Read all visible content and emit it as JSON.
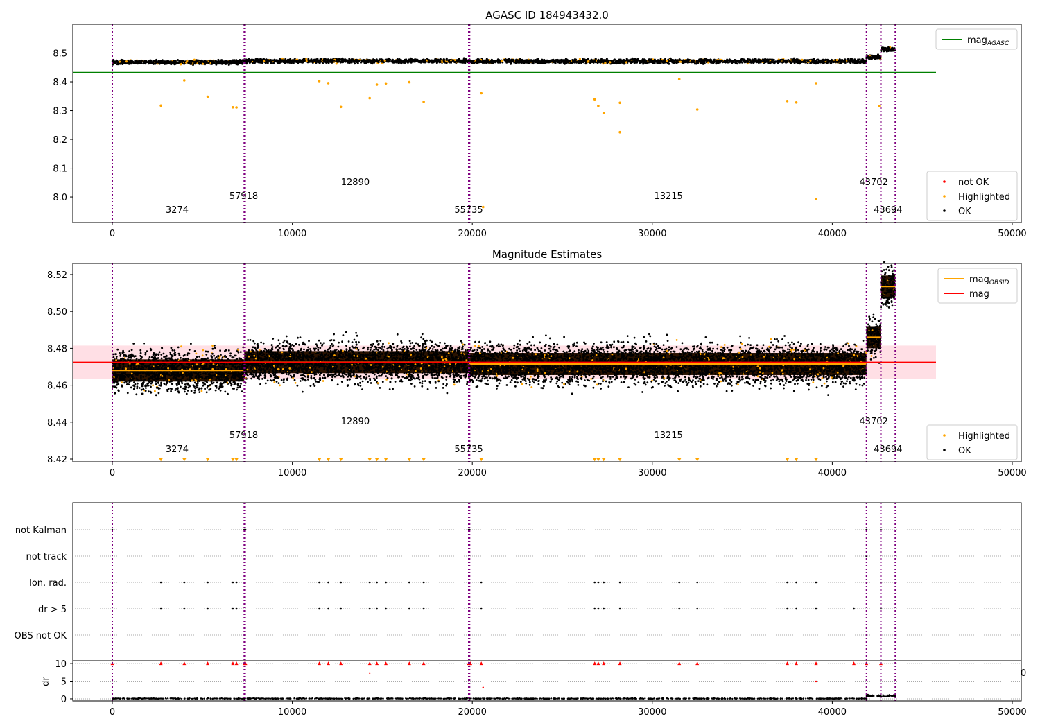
{
  "chart_data": [
    {
      "type": "scatter",
      "title": "AGASC ID 184943432.0",
      "xlim": [
        -2196,
        50500
      ],
      "ylim": [
        7.911,
        8.599
      ],
      "xticks": [
        "0",
        "10000",
        "20000",
        "30000",
        "40000",
        "50000"
      ],
      "yticks": [
        "8.0",
        "8.1",
        "8.2",
        "8.3",
        "8.4",
        "8.5"
      ],
      "mag_agasc": 8.432,
      "legend_top": {
        "position": "upper right",
        "entries": [
          {
            "label": "mag",
            "sub": "AGASC",
            "color": "#008000"
          }
        ]
      },
      "legend_bottom": {
        "position": "lower right",
        "entries": [
          {
            "label": "not OK",
            "color": "#ff0000"
          },
          {
            "label": "Highlighted",
            "color": "#ffa500"
          },
          {
            "label": "OK",
            "color": "#000000"
          }
        ]
      },
      "annotations_y": [
        7.94,
        7.99,
        8.04
      ]
    },
    {
      "type": "scatter",
      "title": "Magnitude Estimates",
      "xlim": [
        -2196,
        50500
      ],
      "ylim": [
        8.4185,
        8.526
      ],
      "xticks": [
        "0",
        "10000",
        "20000",
        "30000",
        "40000",
        "50000"
      ],
      "yticks": [
        "8.42",
        "8.44",
        "8.46",
        "8.48",
        "8.50",
        "8.52"
      ],
      "mag": 8.4724,
      "mag_band": [
        8.4635,
        8.4815
      ],
      "legend_top": {
        "position": "upper right",
        "entries": [
          {
            "label": "mag",
            "sub": "OBSID",
            "color": "#ffa500"
          },
          {
            "label": "mag",
            "sub": "",
            "color": "#ff0000"
          }
        ]
      },
      "legend_bottom": {
        "position": "lower right",
        "entries": [
          {
            "label": "Highlighted",
            "color": "#ffa500"
          },
          {
            "label": "OK",
            "color": "#000000"
          }
        ]
      }
    },
    {
      "type": "scatter",
      "title": "",
      "categories": [
        "not Kalman",
        "not track",
        "Ion. rad.",
        "dr > 5",
        "OBS not OK"
      ],
      "flags": {
        "not Kalman": [
          0,
          7330,
          7400,
          19800,
          19850,
          41900,
          42700
        ],
        "not track": [
          41900
        ],
        "Ion. rad.": [
          2700,
          4000,
          5300,
          6700,
          6900,
          11500,
          12000,
          12700,
          14300,
          14700,
          15200,
          16500,
          17300,
          20500,
          26800,
          27000,
          27300,
          28200,
          31500,
          32500,
          37500,
          38000,
          39100,
          42700
        ],
        "dr > 5": [
          2700,
          4000,
          5300,
          6700,
          6900,
          11500,
          12000,
          12700,
          14300,
          14700,
          15200,
          16500,
          17300,
          20500,
          26800,
          27000,
          27300,
          28200,
          31500,
          32500,
          37500,
          38000,
          39100,
          41200,
          42700
        ],
        "OBS not OK": []
      },
      "dr_panel": {
        "ylabel": "dr",
        "ylim": [
          -0.6,
          10.8
        ],
        "yticks": [
          "0",
          "5",
          "10"
        ],
        "clip_value": 10,
        "clipped_x": [
          0,
          2700,
          4000,
          5300,
          6700,
          6900,
          7330,
          7400,
          11500,
          12000,
          12700,
          14300,
          14700,
          15200,
          16500,
          17300,
          19800,
          19900,
          20500,
          26800,
          27000,
          27300,
          28200,
          31500,
          32500,
          37500,
          38000,
          39100,
          41200,
          41900,
          42700
        ],
        "extra_red": [
          [
            14300,
            7.3
          ],
          [
            20600,
            3.2
          ],
          [
            39100,
            4.9
          ]
        ]
      },
      "xticks": [
        "0",
        "10000",
        "20000",
        "30000",
        "40000",
        "50000"
      ],
      "stray_tick_label": "0"
    }
  ],
  "observations": [
    {
      "obsid": "3274",
      "start": 0,
      "end": 7330,
      "mag": 8.468,
      "label_x": 3600
    },
    {
      "obsid": "57918",
      "start": 7330,
      "end": 19800,
      "mag": 8.4725,
      "label_x": 7300
    },
    {
      "obsid": "12890",
      "start": 19800,
      "end": 41900,
      "mag": 8.4715,
      "label_x": 13500,
      "dummy": false
    },
    {
      "obsid": "55735",
      "start": 19800,
      "end": 19800,
      "mag": 8.4715,
      "label_x": 19800
    },
    {
      "obsid": "13215",
      "start": 41900,
      "end": 41900,
      "mag": 8.4715,
      "label_x": 30900
    },
    {
      "obsid": "43702",
      "start": 41900,
      "end": 42700,
      "mag": 8.486,
      "label_x": 42300
    },
    {
      "obsid": "43694",
      "start": 42700,
      "end": 43500,
      "mag": 8.5135,
      "label_x": 43100
    }
  ],
  "obs_boundaries": [
    0,
    7330,
    7380,
    19800,
    19850,
    41900,
    42700,
    43500
  ],
  "segments": [
    {
      "start": 0,
      "end": 7330,
      "mag": 8.468
    },
    {
      "start": 7330,
      "end": 19800,
      "mag": 8.4725
    },
    {
      "start": 19800,
      "end": 41900,
      "mag": 8.4715
    },
    {
      "start": 41900,
      "end": 42700,
      "mag": 8.486
    },
    {
      "start": 42700,
      "end": 43500,
      "mag": 8.5135
    }
  ],
  "colors": {
    "ok": "#000000",
    "highlighted": "#ffa500",
    "not_ok": "#ff0000",
    "boundary": "#800080",
    "agasc": "#008000",
    "mag": "#ff0000",
    "band": "#ffc0cb"
  }
}
